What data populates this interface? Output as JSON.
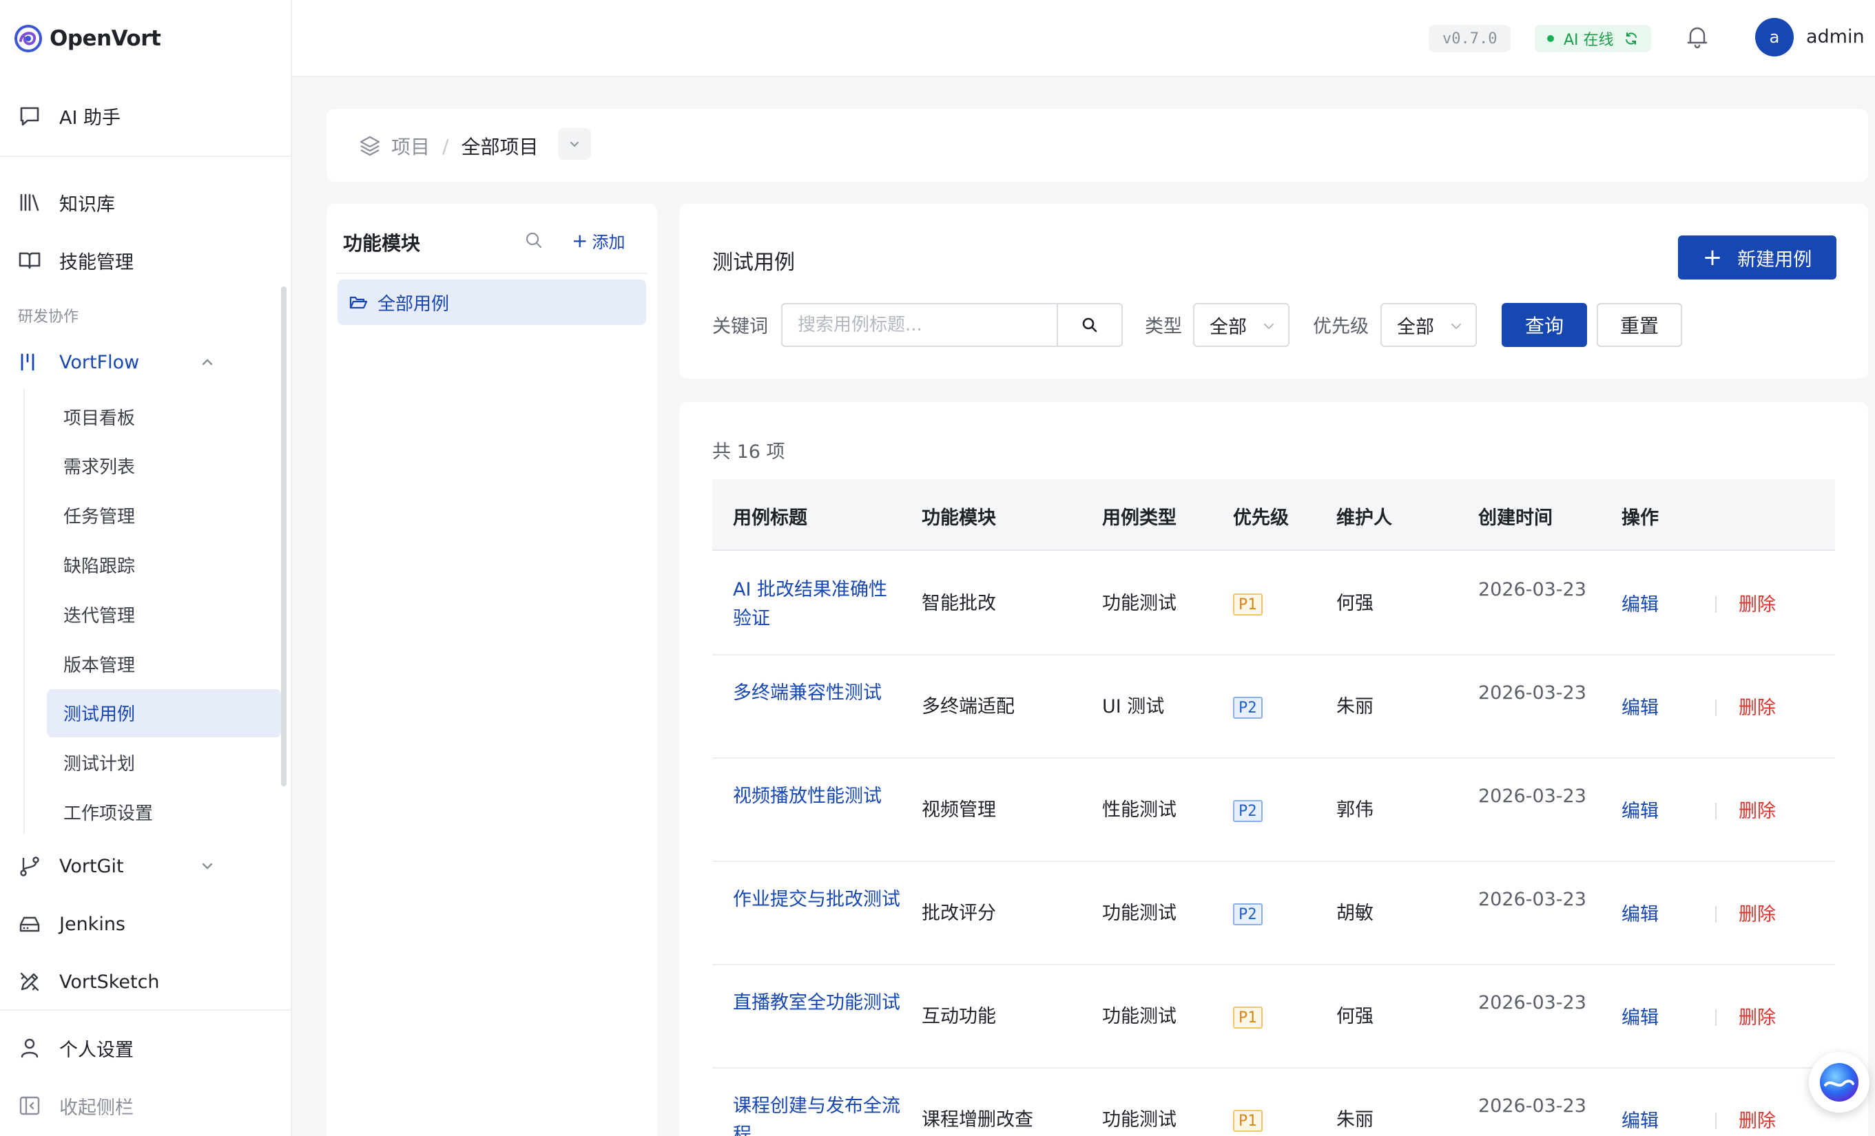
{
  "app": {
    "name": "OpenVort"
  },
  "sidebar": {
    "ai_assistant": "AI 助手",
    "knowledge": "知识库",
    "skills": "技能管理",
    "section_title": "研发协作",
    "vortflow": {
      "label": "VortFlow",
      "items": [
        {
          "label": "项目看板"
        },
        {
          "label": "需求列表"
        },
        {
          "label": "任务管理"
        },
        {
          "label": "缺陷跟踪"
        },
        {
          "label": "迭代管理"
        },
        {
          "label": "版本管理"
        },
        {
          "label": "测试用例"
        },
        {
          "label": "测试计划"
        },
        {
          "label": "工作项设置"
        }
      ],
      "active_index": 6
    },
    "vortgit": "VortGit",
    "jenkins": "Jenkins",
    "vortsketch": "VortSketch",
    "personal_settings": "个人设置",
    "collapse": "收起侧栏"
  },
  "topbar": {
    "version": "v0.7.0",
    "ai_status": "AI 在线",
    "avatar_letter": "a",
    "username": "admin"
  },
  "breadcrumb": {
    "root": "项目",
    "separator": "/",
    "current": "全部项目"
  },
  "module_panel": {
    "title": "功能模块",
    "add_label": "添加",
    "all_cases": "全部用例"
  },
  "filter": {
    "title": "测试用例",
    "new_button": "新建用例",
    "keyword_label": "关键词",
    "keyword_placeholder": "搜索用例标题...",
    "type_label": "类型",
    "type_value": "全部",
    "priority_label": "优先级",
    "priority_value": "全部",
    "query_button": "查询",
    "reset_button": "重置"
  },
  "table": {
    "total": "共 16 项",
    "columns": [
      "用例标题",
      "功能模块",
      "用例类型",
      "优先级",
      "维护人",
      "创建时间",
      "操作"
    ],
    "rows": [
      {
        "title": "AI 批改结果准确性验证",
        "module": "智能批改",
        "type": "功能测试",
        "priority": "P1",
        "owner": "何强",
        "created": "2026-03-23"
      },
      {
        "title": "多终端兼容性测试",
        "module": "多终端适配",
        "type": "UI 测试",
        "priority": "P2",
        "owner": "朱丽",
        "created": "2026-03-23"
      },
      {
        "title": "视频播放性能测试",
        "module": "视频管理",
        "type": "性能测试",
        "priority": "P2",
        "owner": "郭伟",
        "created": "2026-03-23"
      },
      {
        "title": "作业提交与批改测试",
        "module": "批改评分",
        "type": "功能测试",
        "priority": "P2",
        "owner": "胡敏",
        "created": "2026-03-23"
      },
      {
        "title": "直播教室全功能测试",
        "module": "互动功能",
        "type": "功能测试",
        "priority": "P1",
        "owner": "何强",
        "created": "2026-03-23"
      },
      {
        "title": "课程创建与发布全流程",
        "module": "课程增删改查",
        "type": "功能测试",
        "priority": "P1",
        "owner": "朱丽",
        "created": "2026-03-23"
      }
    ],
    "edit_label": "编辑",
    "delete_label": "删除"
  },
  "colors": {
    "primary": "#1747b3",
    "danger": "#e0322d",
    "online": "#1a9d4a"
  }
}
